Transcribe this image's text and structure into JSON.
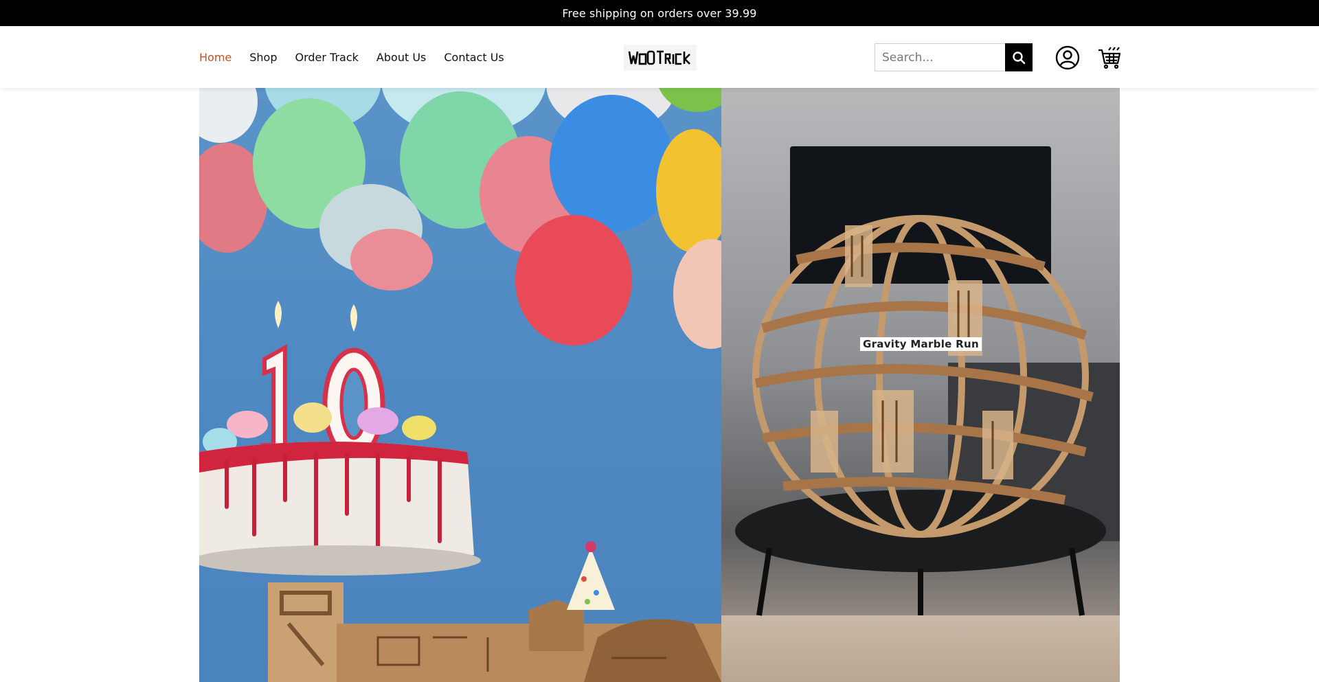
{
  "announcement": {
    "text": "Free shipping on orders over 39.99"
  },
  "nav": {
    "items": [
      {
        "label": "Home",
        "active": true
      },
      {
        "label": "Shop"
      },
      {
        "label": "Order Track"
      },
      {
        "label": "About Us"
      },
      {
        "label": "Contact Us"
      }
    ]
  },
  "logo": {
    "text": "WoODTRICK"
  },
  "search": {
    "placeholder": "Search..."
  },
  "icons": {
    "search": "search-icon",
    "account": "user-circle-icon",
    "cart": "shopping-cart-icon"
  },
  "hero": {
    "right_label": "Gravity Marble Run",
    "cake_number": "10"
  },
  "colors": {
    "accent": "#c8501e",
    "announcement_bg": "#000000"
  }
}
